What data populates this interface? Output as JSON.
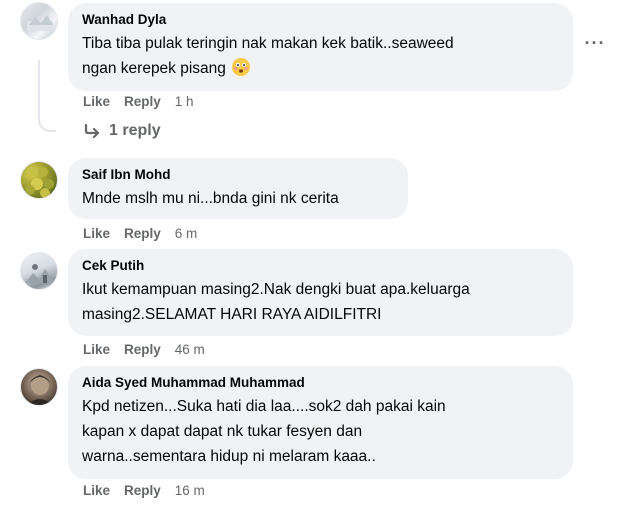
{
  "comments": [
    {
      "author": "Wanhad Dyla",
      "lines": [
        "Tiba tiba pulak teringin nak makan kek batik..seaweed",
        "ngan kerepek pisang"
      ],
      "emoji": "flushed-face-emoji",
      "like": "Like",
      "reply": "Reply",
      "time": "1 h"
    },
    {
      "author": "Saif Ibn Mohd",
      "lines": [
        "Mnde mslh mu ni...bnda gini nk cerita"
      ],
      "like": "Like",
      "reply": "Reply",
      "time": "6 m"
    },
    {
      "author": "Cek Putih",
      "lines": [
        "Ikut kemampuan masing2.Nak dengki buat apa.keluarga",
        "masing2.SELAMAT HARI RAYA AIDILFITRI"
      ],
      "like": "Like",
      "reply": "Reply",
      "time": "46 m"
    },
    {
      "author": "Aida Syed Muhammad Muhammad",
      "lines": [
        "Kpd netizen...Suka hati dia laa....sok2 dah pakai kain",
        "kapan x dapat dapat nk tukar fesyen dan",
        "warna..sementara hidup ni melaram kaaa.."
      ],
      "like": "Like",
      "reply": "Reply",
      "time": "16 m"
    }
  ],
  "thread": {
    "replies_label": "1 reply",
    "icon": "reply-arrow-icon"
  },
  "more_icon": "more-options-icon",
  "colors": {
    "bubble": "#f0f2f5",
    "meta": "#65676b",
    "text": "#050505"
  }
}
